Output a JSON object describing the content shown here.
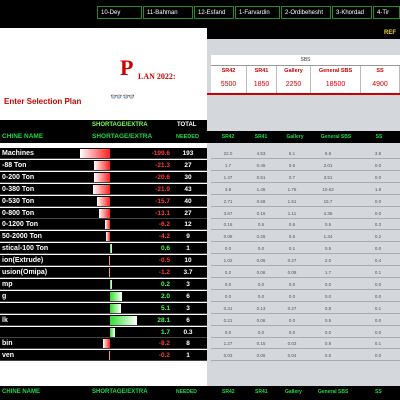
{
  "tabs": [
    "10-Dey",
    "11-Bahman",
    "12-Esfand",
    "1-Farvardin",
    "2-Ordibehesht",
    "3-Khordad",
    "4-Tir"
  ],
  "logo": {
    "first_letter": "P",
    "rest": "LAN 2022:"
  },
  "enter_label": "Enter Selection Plan",
  "ref_label": "REF",
  "sbs_label": "SBS",
  "top_columns": [
    {
      "label": "SR42",
      "value": "5500"
    },
    {
      "label": "SR41",
      "value": "1850"
    },
    {
      "label": "Gallery",
      "value": "2250"
    },
    {
      "label": "General SBS",
      "value": "18500"
    },
    {
      "label": "SS",
      "value": "4900"
    }
  ],
  "shortage_header": {
    "machine": "CHINE NAME",
    "shortage": "SHORTAGE/EXTRA",
    "total": "TOTAL",
    "needed": "NEEDED"
  },
  "right_headers": [
    "SR42",
    "SR41",
    "Gallery",
    "General SBS",
    "SS"
  ],
  "rows": [
    {
      "name": "Machines",
      "value": "-199.6",
      "needed": "193",
      "bar": -1.0,
      "grid": [
        "22.0",
        "4.53",
        "6.1",
        "6.8",
        "3.8"
      ]
    },
    {
      "name": "-88 Ton",
      "value": "-21.3",
      "needed": "27",
      "bar": -0.55,
      "grid": [
        "1.7",
        "0.45",
        "0.6",
        "2.01",
        "0.0"
      ]
    },
    {
      "name": "0-200 Ton",
      "value": "-20.6",
      "needed": "30",
      "bar": -0.55,
      "grid": [
        "1.47",
        "0.61",
        "0.7",
        "3.51",
        "0.0"
      ]
    },
    {
      "name": "0-380 Ton",
      "value": "-21.9",
      "needed": "43",
      "bar": -0.57,
      "grid": [
        "3.8",
        "1.46",
        "1.76",
        "10.63",
        "1.9"
      ]
    },
    {
      "name": "0-530 Ton",
      "value": "-15.7",
      "needed": "40",
      "bar": -0.42,
      "grid": [
        "2.71",
        "0.68",
        "1.51",
        "15.7",
        "0.0"
      ]
    },
    {
      "name": "0-800 Ton",
      "value": "-13.1",
      "needed": "27",
      "bar": -0.36,
      "grid": [
        "3.67",
        "0.16",
        "1.11",
        "4.36",
        "0.0"
      ]
    },
    {
      "name": "0-1200 Ton",
      "value": "-6.2",
      "needed": "12",
      "bar": -0.18,
      "grid": [
        "0.16",
        "0.5",
        "0.6",
        "0.5",
        "0.3"
      ]
    },
    {
      "name": "50-2000 Ton",
      "value": "-4.2",
      "needed": "9",
      "bar": -0.12,
      "grid": [
        "0.06",
        "0.26",
        "0.6",
        "1.34",
        "0.2"
      ]
    },
    {
      "name": "stical-100 Ton",
      "value": "0.6",
      "needed": "1",
      "bar": 0.03,
      "grid": [
        "0.0",
        "0.0",
        "0.1",
        "0.5",
        "0.0"
      ]
    },
    {
      "name": "ion(Extrude)",
      "value": "-0.5",
      "needed": "10",
      "bar": -0.03,
      "grid": [
        "1.02",
        "0.06",
        "0.27",
        "2.0",
        "0.4"
      ]
    },
    {
      "name": "usion(Omipa)",
      "value": "-1.2",
      "needed": "3.7",
      "bar": -0.05,
      "grid": [
        "0.2",
        "0.06",
        "0.08",
        "1.7",
        "0.1"
      ]
    },
    {
      "name": "mp",
      "value": "0.2",
      "needed": "3",
      "bar": 0.03,
      "grid": [
        "0.0",
        "0.0",
        "0.0",
        "0.0",
        "0.0"
      ]
    },
    {
      "name": "g",
      "value": "2.0",
      "needed": "6",
      "bar": 0.4,
      "grid": [
        "0.0",
        "0.0",
        "0.0",
        "0.0",
        "0.0"
      ]
    },
    {
      "name": "",
      "value": "5.1",
      "needed": "3",
      "bar": 0.35,
      "grid": [
        "0.31",
        "0.13",
        "0.27",
        "0.8",
        "0.1"
      ]
    },
    {
      "name": "lk",
      "value": "28.1",
      "needed": "6",
      "bar": 0.9,
      "grid": [
        "0.21",
        "0.06",
        "0.0",
        "0.5",
        "0.0"
      ]
    },
    {
      "name": "",
      "value": "1.7",
      "needed": "0.3",
      "bar": 0.15,
      "grid": [
        "0.0",
        "0.0",
        "0.0",
        "0.0",
        "0.0"
      ]
    },
    {
      "name": "bin",
      "value": "-8.2",
      "needed": "8",
      "bar": -0.25,
      "grid": [
        "1.27",
        "0.15",
        "0.03",
        "0.8",
        "0.1"
      ]
    },
    {
      "name": "ven",
      "value": "-0.2",
      "needed": "1",
      "bar": -0.03,
      "grid": [
        "0.03",
        "0.06",
        "0.04",
        "0.5",
        "0.0"
      ]
    }
  ],
  "colors": {
    "negative": "#ff2020",
    "positive": "#2ee02e",
    "header_green": "#1fd94a"
  }
}
